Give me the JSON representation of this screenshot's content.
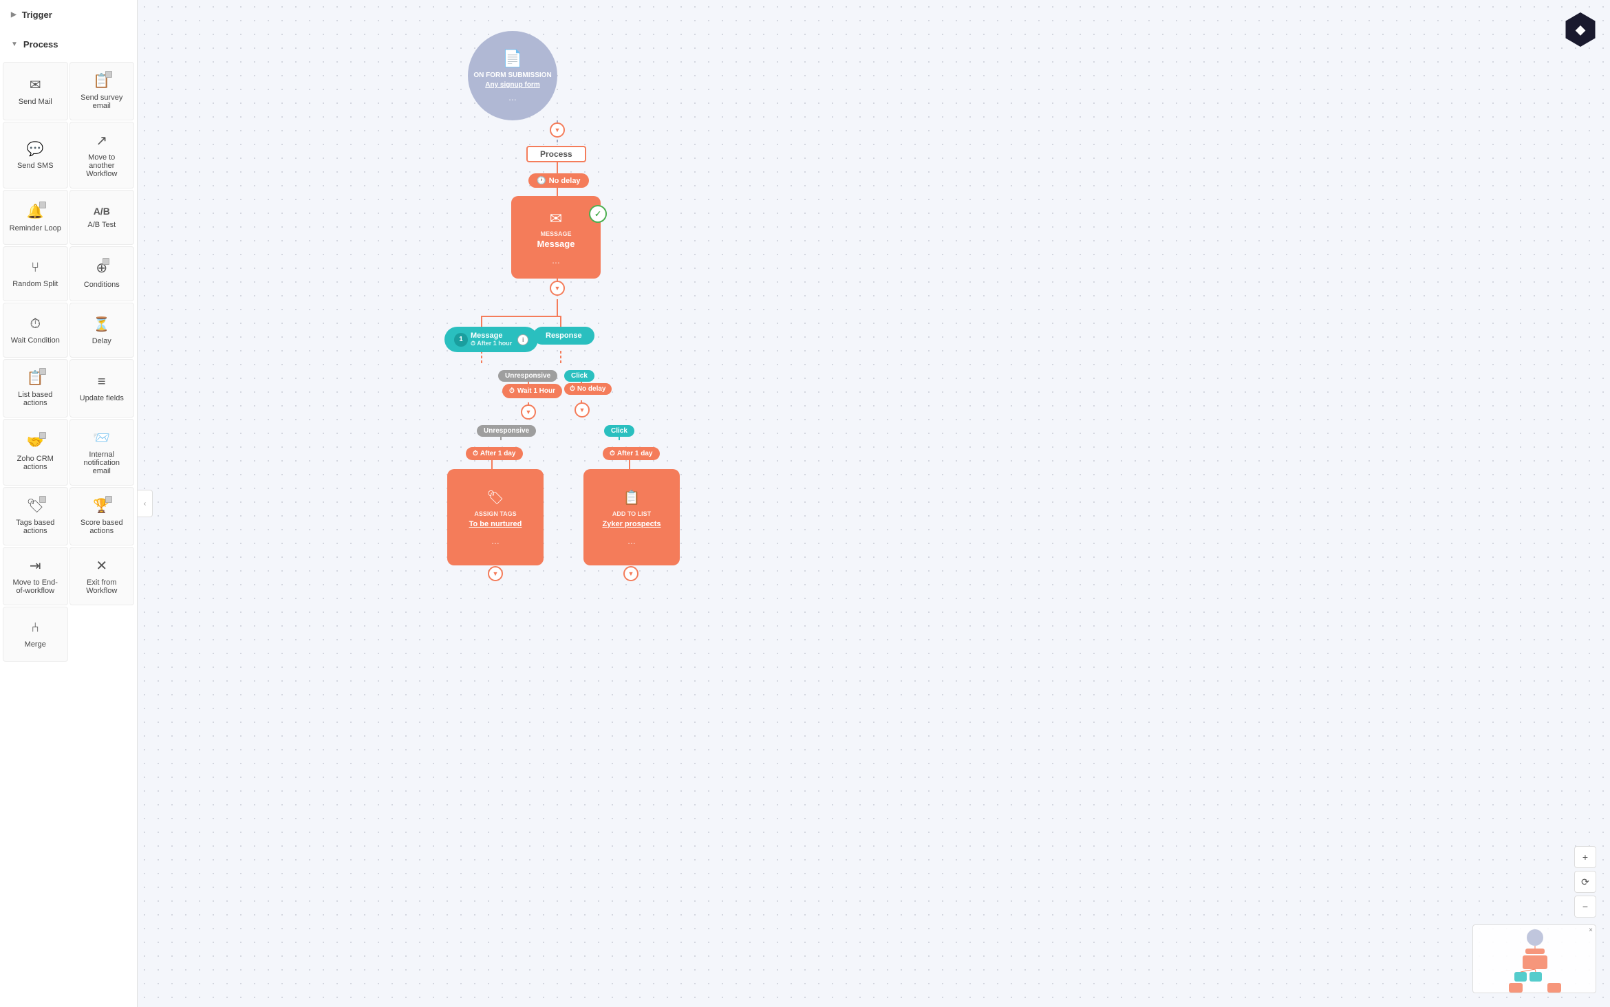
{
  "sidebar": {
    "trigger_label": "Trigger",
    "process_label": "Process",
    "items": [
      {
        "id": "send-mail",
        "label": "Send Mail",
        "icon": "✉"
      },
      {
        "id": "send-survey",
        "label": "Send survey email",
        "icon": "📋",
        "layered": true
      },
      {
        "id": "send-sms",
        "label": "Send SMS",
        "icon": "💬"
      },
      {
        "id": "move-workflow",
        "label": "Move to another Workflow",
        "icon": "↗"
      },
      {
        "id": "reminder-loop",
        "label": "Reminder Loop",
        "icon": "🔔",
        "layered": true
      },
      {
        "id": "ab-test",
        "label": "A/B Test",
        "icon": "A/B"
      },
      {
        "id": "random-split",
        "label": "Random Split",
        "icon": "⑂"
      },
      {
        "id": "conditions",
        "label": "Conditions",
        "icon": "⊕",
        "layered": true
      },
      {
        "id": "wait-condition",
        "label": "Wait Condition",
        "icon": "⏱"
      },
      {
        "id": "delay",
        "label": "Delay",
        "icon": "⏳"
      },
      {
        "id": "list-based",
        "label": "List based actions",
        "icon": "📋",
        "layered": true
      },
      {
        "id": "update-fields",
        "label": "Update fields",
        "icon": "≡"
      },
      {
        "id": "zoho-crm",
        "label": "Zoho CRM actions",
        "icon": "🤝",
        "layered": true
      },
      {
        "id": "internal-notification",
        "label": "Internal notification email",
        "icon": "📨"
      },
      {
        "id": "tags-based",
        "label": "Tags based actions",
        "icon": "🏷",
        "layered": true
      },
      {
        "id": "score-based",
        "label": "Score based actions",
        "icon": "🏆",
        "layered": true
      },
      {
        "id": "move-end",
        "label": "Move to End-of-workflow",
        "icon": "⇥"
      },
      {
        "id": "exit-workflow",
        "label": "Exit from Workflow",
        "icon": "✕"
      },
      {
        "id": "merge",
        "label": "Merge",
        "icon": "⑃"
      }
    ]
  },
  "canvas": {
    "trigger_node": {
      "label": "ON FORM SUBMISSION",
      "link": "Any signup form",
      "dots": "..."
    },
    "process_label": "Process",
    "no_delay_badge": "No delay",
    "message_node": {
      "label": "MESSAGE",
      "value": "Message",
      "dots": "..."
    },
    "message_after_hour": {
      "number": "1",
      "label": "Message",
      "sublabel": "After 1 hour"
    },
    "response_label": "Response",
    "unresponsive_label": "Unresponsive",
    "wait_1_hour": "Wait 1 Hour",
    "click_label": "Click",
    "no_delay_click": "No delay",
    "assign_tags_node": {
      "delay": "After 1 day",
      "label": "ASSIGN TAGS",
      "value": "To be nurtured",
      "dots": "..."
    },
    "add_to_list_node": {
      "delay": "After 1 day",
      "label": "ADD TO LIST",
      "value": "Zyker prospects",
      "dots": "..."
    }
  },
  "minimap": {
    "close": "×"
  },
  "zoom": {
    "zoom_in": "+",
    "zoom_reset": "⟳",
    "zoom_out": "−"
  },
  "logo": "◆"
}
